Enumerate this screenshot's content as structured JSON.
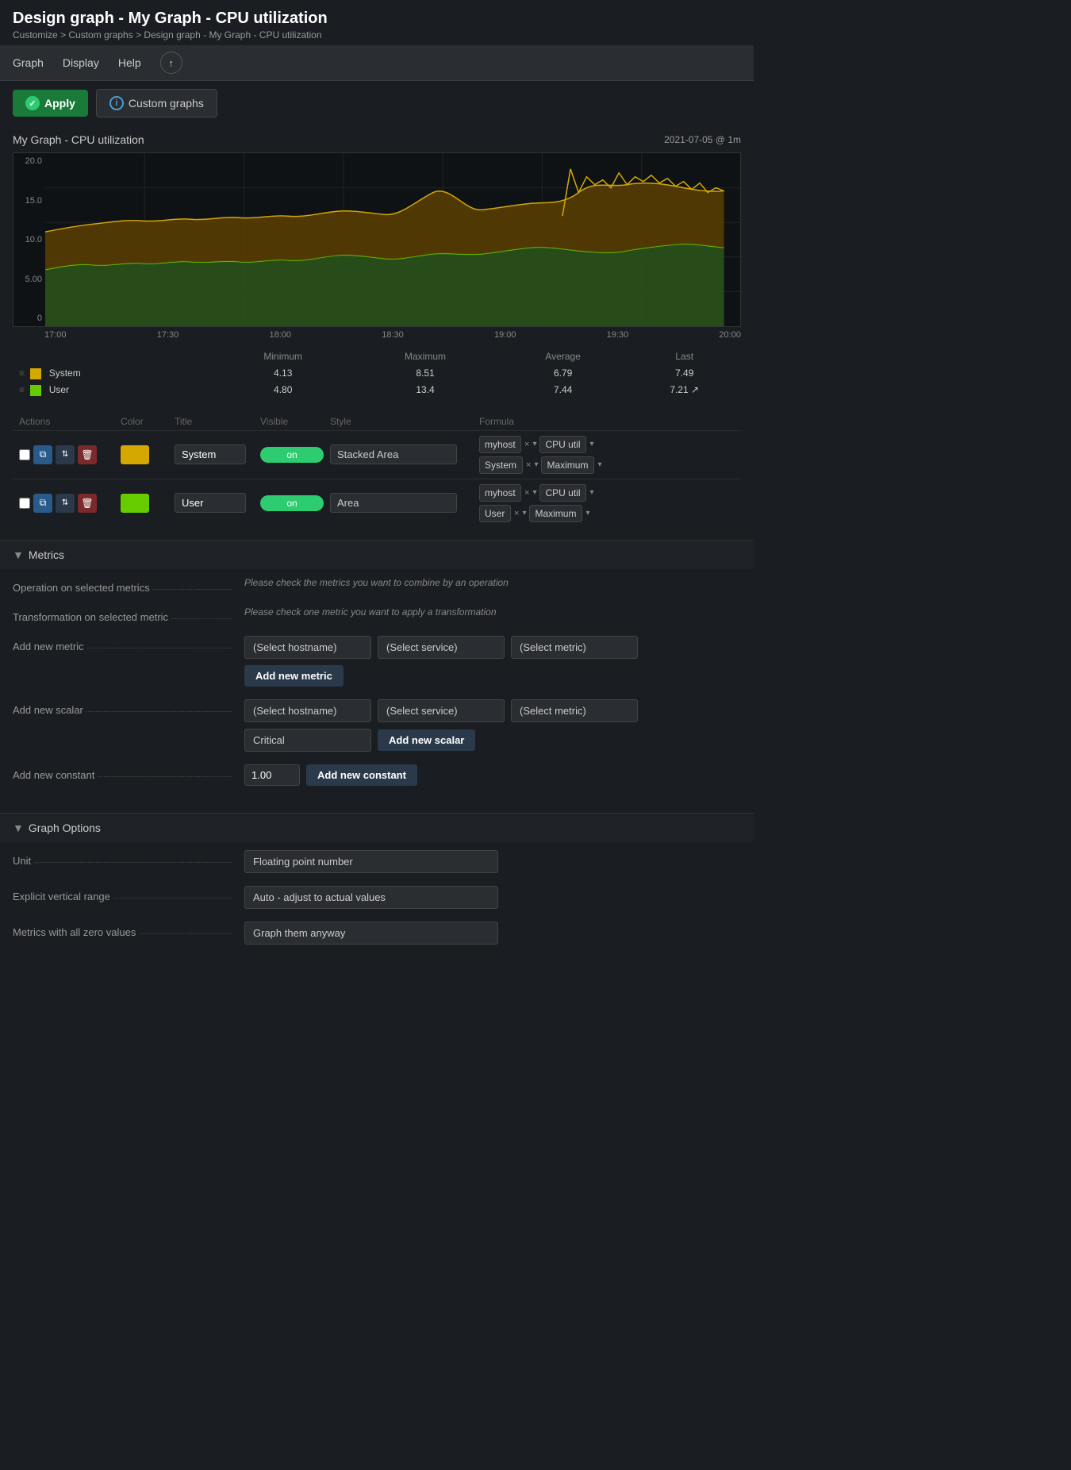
{
  "page": {
    "title": "Design graph - My Graph - CPU utilization",
    "breadcrumb": "Customize > Custom graphs > Design graph - My Graph - CPU utilization"
  },
  "nav": {
    "items": [
      "Graph",
      "Display",
      "Help"
    ],
    "icon_label": "↑"
  },
  "toolbar": {
    "apply_label": "Apply",
    "custom_graphs_label": "Custom graphs"
  },
  "graph": {
    "title": "My Graph - CPU utilization",
    "timestamp": "2021-07-05 @ 1m",
    "y_axis": [
      "20.0",
      "15.0",
      "10.0",
      "5.00",
      "0"
    ],
    "x_axis": [
      "17:00",
      "17:30",
      "18:00",
      "18:30",
      "19:00",
      "19:30",
      "20:00"
    ],
    "legend": {
      "columns": [
        "",
        "Minimum",
        "Maximum",
        "Average",
        "Last"
      ],
      "rows": [
        {
          "color": "#d4a800",
          "label": "System",
          "min": "4.13",
          "max": "8.51",
          "avg": "6.79",
          "last": "7.49"
        },
        {
          "color": "#66cc00",
          "label": "User",
          "min": "4.80",
          "max": "13.4",
          "avg": "7.44",
          "last": "7.21"
        }
      ]
    }
  },
  "data_rows": {
    "headers": [
      "Actions",
      "Color",
      "Title",
      "Visible",
      "Style",
      "Formula"
    ],
    "rows": [
      {
        "title": "System",
        "color": "#d4a800",
        "visible": "on",
        "style": "Stacked Area",
        "formula": [
          {
            "host": "myhost",
            "metric": "CPU util"
          },
          {
            "host": "System",
            "metric": "Maximum"
          }
        ]
      },
      {
        "title": "User",
        "color": "#66cc00",
        "visible": "on",
        "style": "Area",
        "formula": [
          {
            "host": "myhost",
            "metric": "CPU util"
          },
          {
            "host": "User",
            "metric": "Maximum"
          }
        ]
      }
    ]
  },
  "metrics_section": {
    "title": "Metrics",
    "rows": [
      {
        "label": "Operation on selected metrics",
        "note": "Please check the metrics you want to combine by an operation"
      },
      {
        "label": "Transformation on selected metric",
        "note": "Please check one metric you want to apply a transformation"
      },
      {
        "label": "Add new metric",
        "controls": [
          "(Select hostname)",
          "(Select service)",
          "(Select metric)",
          "Add new metric"
        ]
      },
      {
        "label": "Add new scalar",
        "controls": [
          "(Select hostname)",
          "(Select service)",
          "(Select metric)",
          "Critical",
          "Add new scalar"
        ]
      },
      {
        "label": "Add new constant",
        "controls": [
          "1.00",
          "Add new constant"
        ]
      }
    ]
  },
  "graph_options_section": {
    "title": "Graph Options",
    "rows": [
      {
        "label": "Unit",
        "value": "Floating point number"
      },
      {
        "label": "Explicit vertical range",
        "value": "Auto - adjust to actual values"
      },
      {
        "label": "Metrics with all zero values",
        "value": "Graph them anyway"
      }
    ]
  }
}
